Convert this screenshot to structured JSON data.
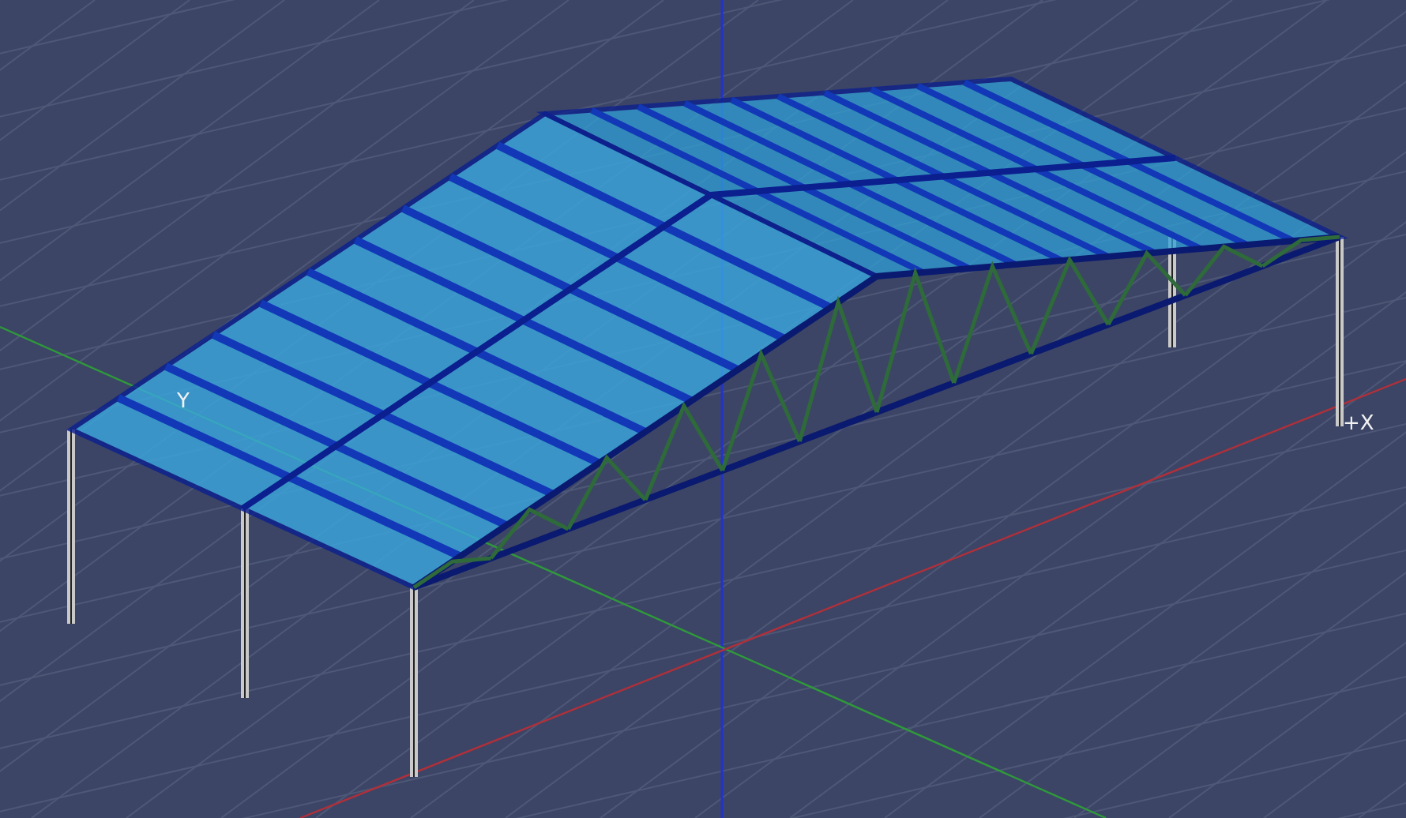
{
  "viewport": {
    "axis_labels": [
      {
        "kind": "y",
        "text": "Y"
      },
      {
        "kind": "x",
        "text": "+X"
      }
    ]
  }
}
